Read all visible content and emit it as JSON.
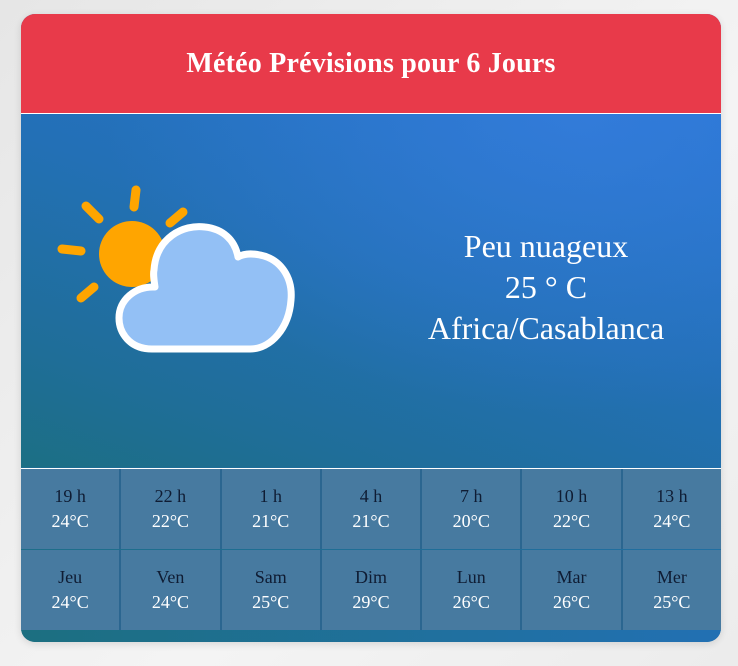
{
  "header": {
    "title": "Météo Prévisions pour 6 Jours"
  },
  "current": {
    "condition": "Peu nuageux",
    "temperature": "25 ° C",
    "location": "Africa/Casablanca",
    "icon": "sun-behind-cloud-icon"
  },
  "colors": {
    "header_bg": "#e83a4a",
    "grid_bg": "#477aa0",
    "sun": "#ffa500",
    "cloud": "#93c0f5"
  },
  "hourly": [
    {
      "time": "19 h",
      "temp": "24°C"
    },
    {
      "time": "22 h",
      "temp": "22°C"
    },
    {
      "time": "1 h",
      "temp": "21°C"
    },
    {
      "time": "4 h",
      "temp": "21°C"
    },
    {
      "time": "7 h",
      "temp": "20°C"
    },
    {
      "time": "10 h",
      "temp": "22°C"
    },
    {
      "time": "13 h",
      "temp": "24°C"
    }
  ],
  "daily": [
    {
      "day": "Jeu",
      "temp": "24°C"
    },
    {
      "day": "Ven",
      "temp": "24°C"
    },
    {
      "day": "Sam",
      "temp": "25°C"
    },
    {
      "day": "Dim",
      "temp": "29°C"
    },
    {
      "day": "Lun",
      "temp": "26°C"
    },
    {
      "day": "Mar",
      "temp": "26°C"
    },
    {
      "day": "Mer",
      "temp": "25°C"
    }
  ]
}
